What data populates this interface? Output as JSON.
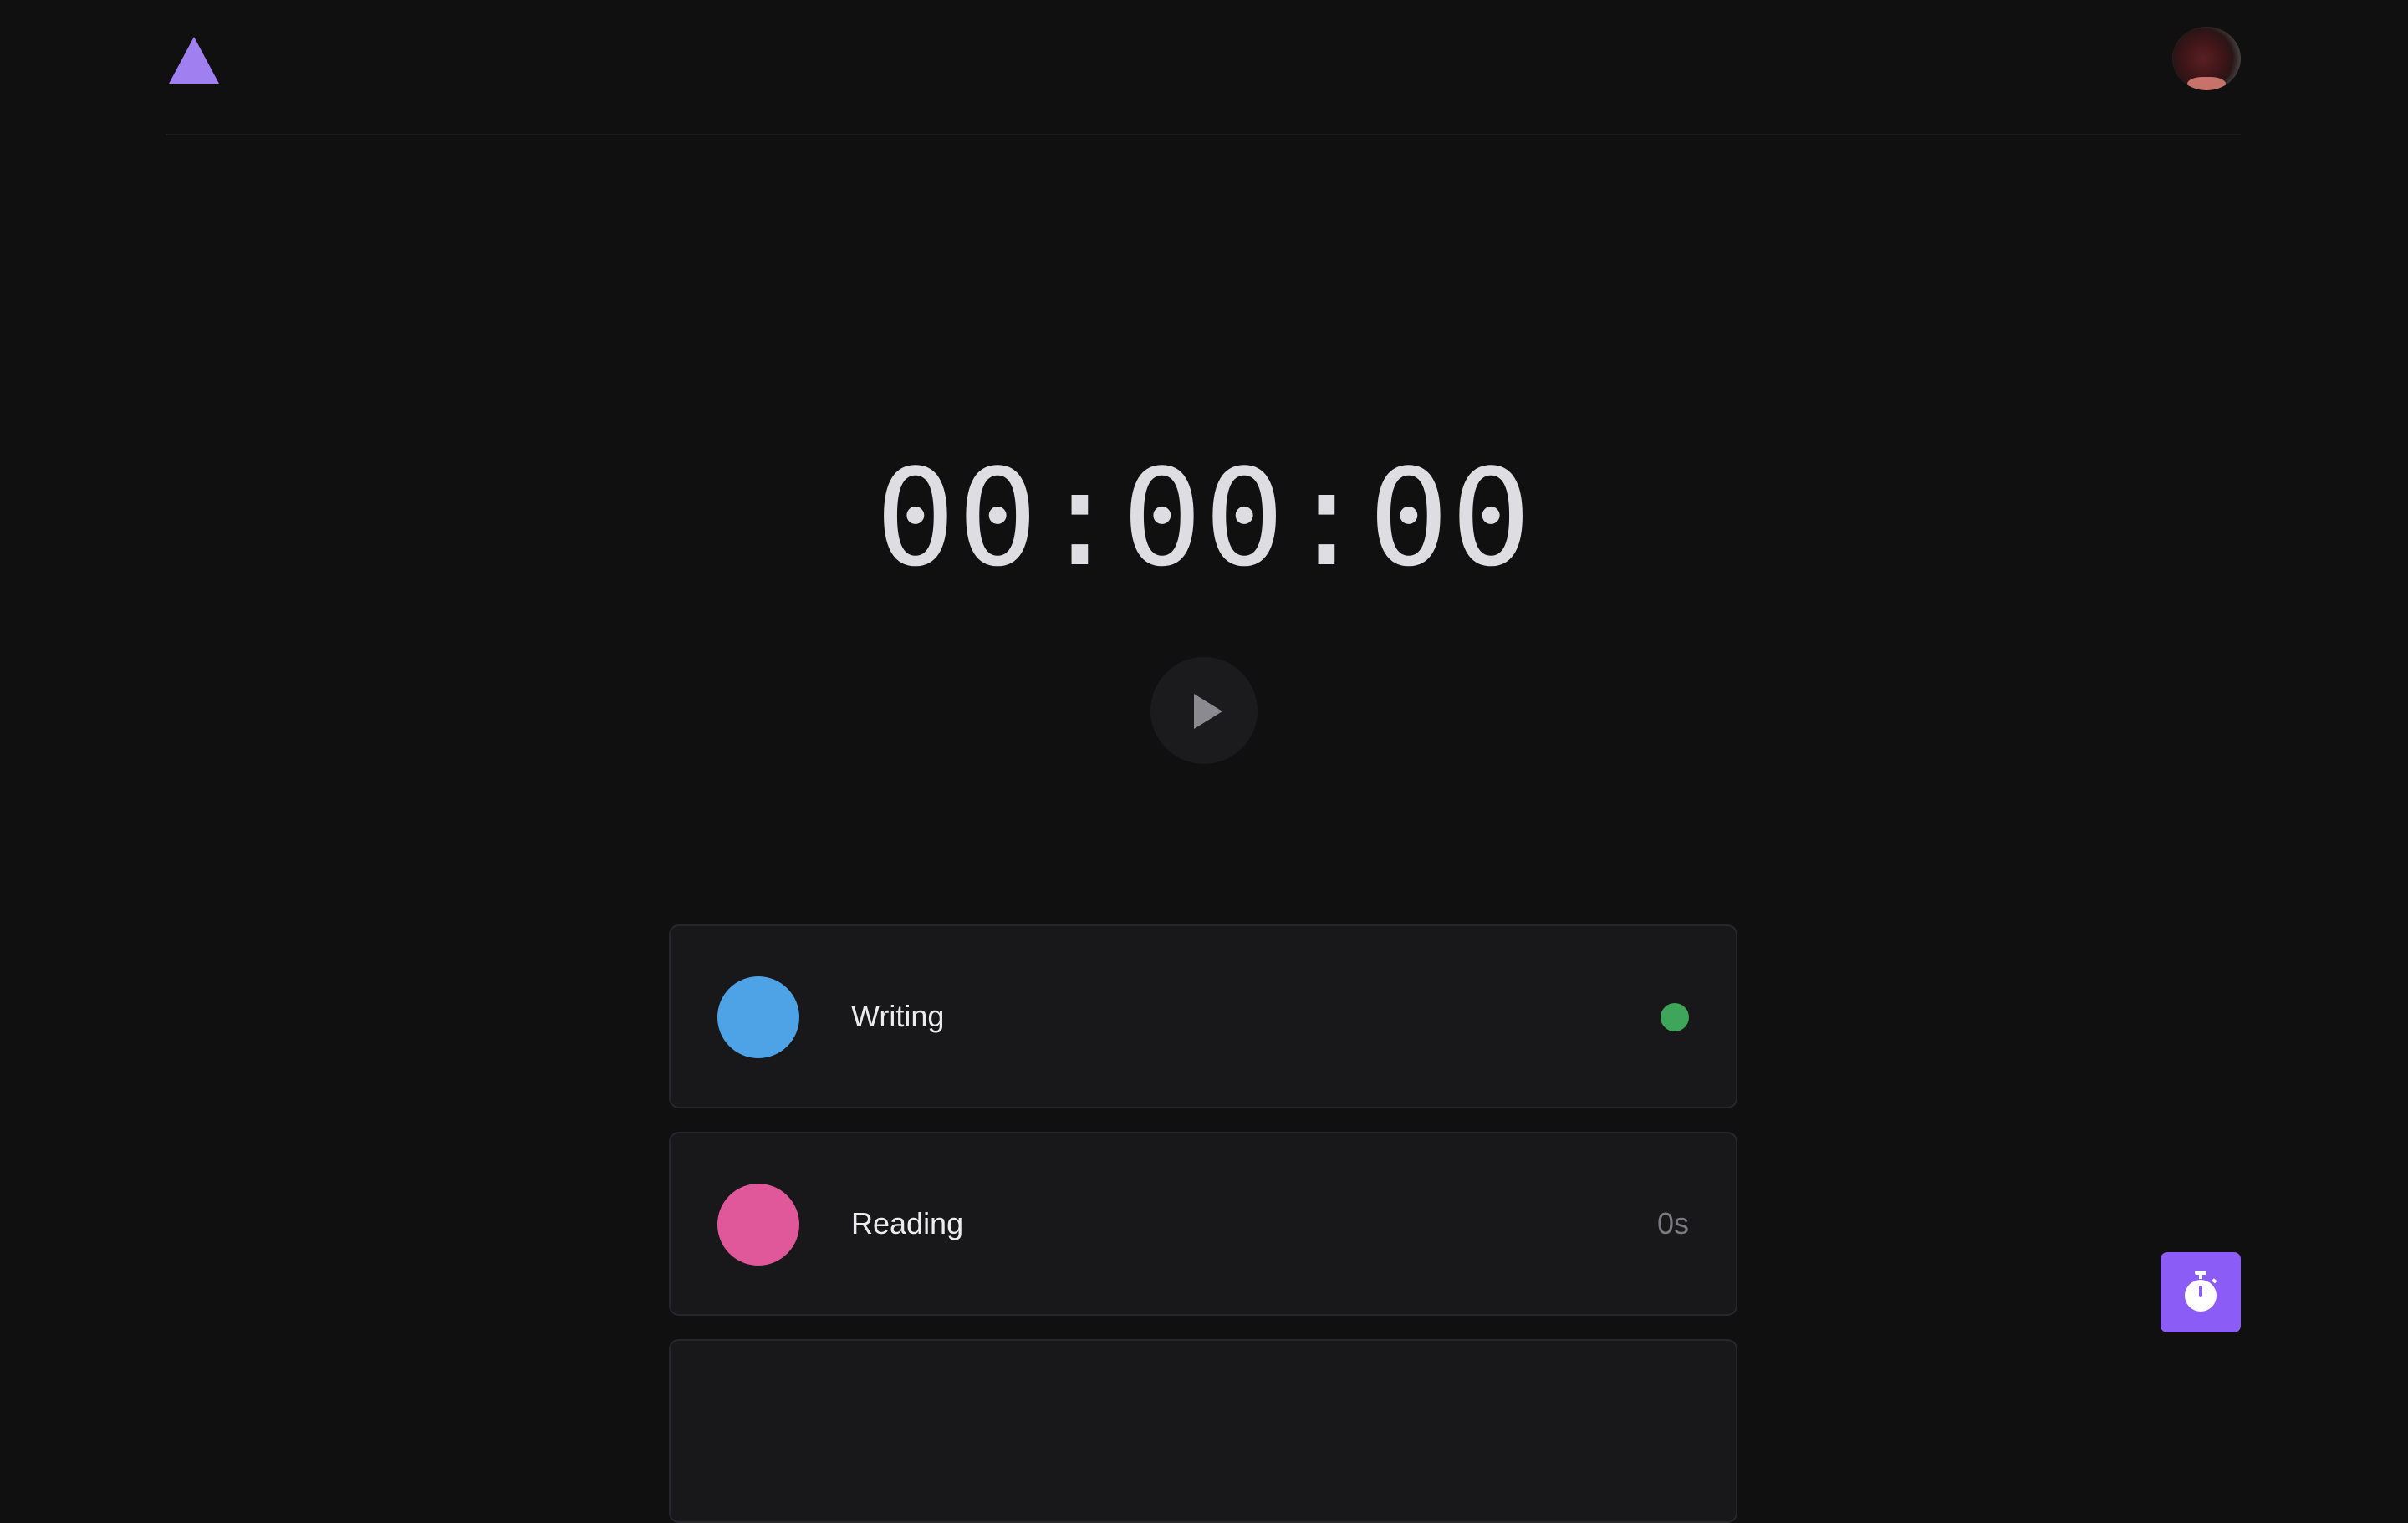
{
  "header": {
    "logo_icon": "triangle-logo-icon",
    "brand_color": "#a07ff0",
    "avatar_icon": "user-avatar"
  },
  "timer": {
    "display": "00:00:00"
  },
  "play_button": {
    "icon": "play-icon"
  },
  "activities": [
    {
      "label": "Writing",
      "color": "#4ea3e6",
      "status": "active",
      "status_color": "#3fa55a",
      "time": ""
    },
    {
      "label": "Reading",
      "color": "#e0589a",
      "time": "0s"
    },
    {
      "label": "",
      "color": ""
    }
  ],
  "fab": {
    "icon": "stopwatch-icon",
    "color": "#8b5cf6"
  }
}
